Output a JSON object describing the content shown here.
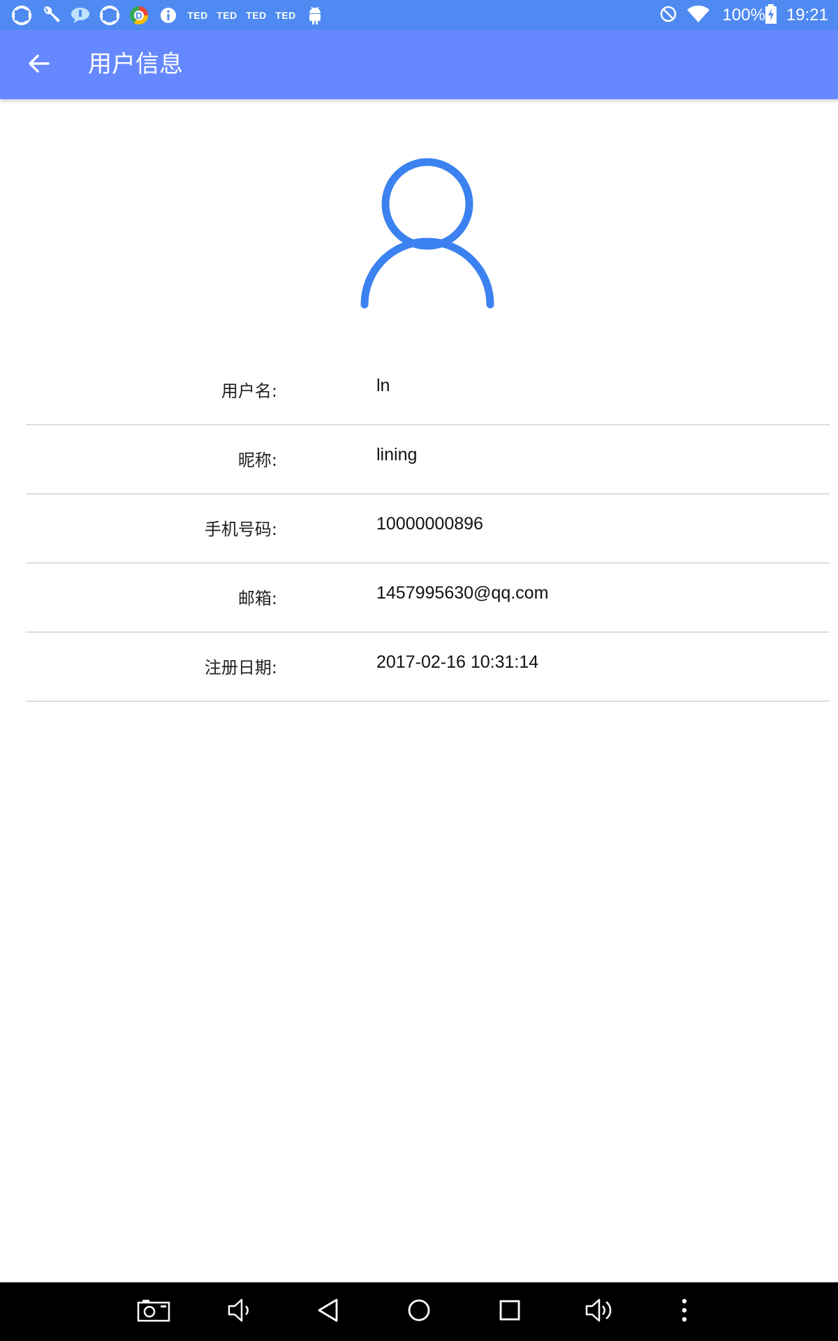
{
  "status_bar": {
    "left_icons": [
      "sync-icon",
      "wrench-icon",
      "chat-bubble-icon",
      "sync-icon",
      "chrome-icon",
      "info-icon",
      "ted-icon",
      "ted-icon",
      "ted-icon",
      "ted-icon",
      "android-icon"
    ],
    "ted_label": "TED",
    "battery_text": "100%",
    "time": "19:21"
  },
  "app_bar": {
    "title": "用户信息",
    "background": "#6688ff"
  },
  "avatar": {
    "icon": "user-avatar-icon",
    "color": "#3b82f0"
  },
  "user_info": {
    "rows": [
      {
        "label": "用户名:",
        "value": "ln"
      },
      {
        "label": "昵称:",
        "value": "lining"
      },
      {
        "label": "手机号码:",
        "value": "10000000896"
      },
      {
        "label": "邮箱:",
        "value": "1457995630@qq.com"
      },
      {
        "label": "注册日期:",
        "value": "2017-02-16 10:31:14"
      }
    ]
  },
  "nav_bar": {
    "buttons": [
      "screenshot-icon",
      "volume-down-icon",
      "back-icon",
      "home-icon",
      "recents-icon",
      "volume-up-icon",
      "more-icon"
    ]
  },
  "colors": {
    "status_bar": "#4f8af2",
    "app_bar": "#6688ff",
    "accent": "#3b82f0",
    "divider": "#dedede",
    "nav_bar": "#000000"
  }
}
